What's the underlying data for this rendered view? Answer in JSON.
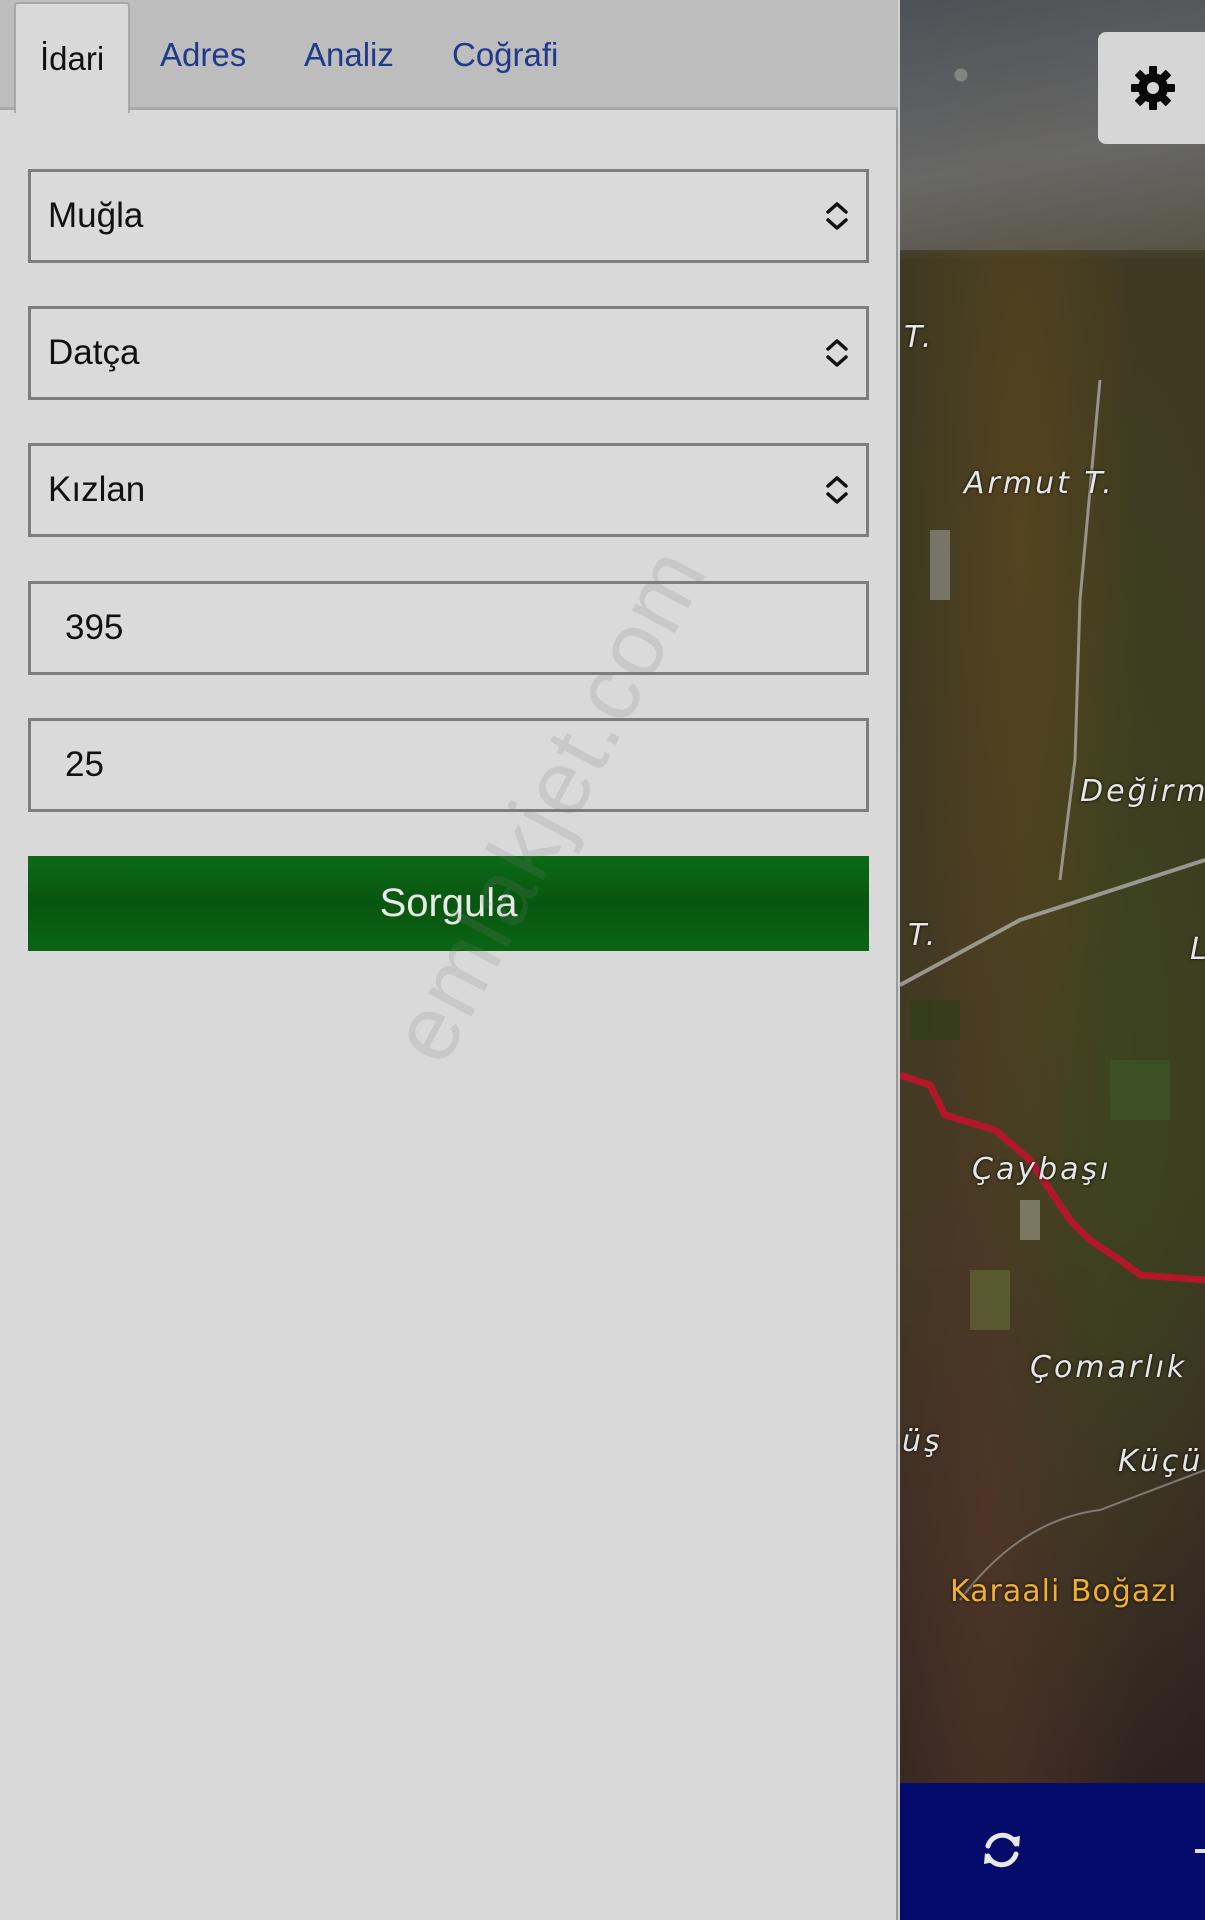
{
  "tabs": [
    "İdari",
    "Adres",
    "Analiz",
    "Coğrafi"
  ],
  "form": {
    "il": "Muğla",
    "ilce": "Datça",
    "mahalle": "Kızlan",
    "ada": "395",
    "parsel": "25",
    "submit_label": "Sorgula"
  },
  "watermark": "emlakjet.com",
  "map": {
    "labels": {
      "t1": "T.",
      "armut": "Armut T.",
      "degirm": "Değirm",
      "t2": "T.",
      "l": "L",
      "caybasi": "Çaybaşı",
      "comarlik": "Çomarlık",
      "us": "üş",
      "kucu": "Küçü",
      "karaali": "Karaali Boğazı"
    }
  },
  "icons": {
    "settings": "gear-icon",
    "refresh": "refresh-icon",
    "select": "chevron-updown-icon"
  },
  "colors": {
    "panel_bg": "#d9d9d9",
    "tab_text": "#1f3a8a",
    "submit_bg": "#0a5f13",
    "toolbar_bg": "#040b6a",
    "boundary": "#b3182a"
  }
}
